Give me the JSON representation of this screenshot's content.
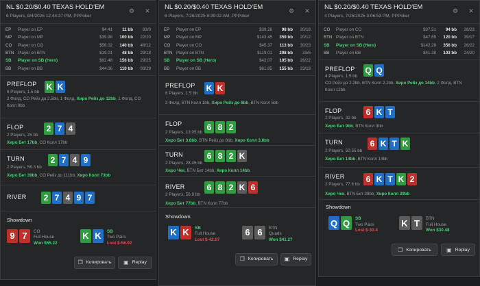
{
  "panels": [
    {
      "title": "NL $0.20/$0.40 TEXAS HOLD'EM",
      "subtitle": "6 Players, 8/4/2025 12:44:37 PM, PPPoker",
      "players": [
        {
          "pos": "EP",
          "name": "Player on EP",
          "stack": "$4.41",
          "bb": "11 bb",
          "stat": "83/0",
          "hero": false
        },
        {
          "pos": "MP",
          "name": "Player on MP",
          "stack": "$39.98",
          "bb": "100 bb",
          "stat": "22/20",
          "hero": false
        },
        {
          "pos": "CO",
          "name": "Player on CO",
          "stack": "$56.02",
          "bb": "140 bb",
          "stat": "46/12",
          "hero": false
        },
        {
          "pos": "BTN",
          "name": "Player on BTN",
          "stack": "$19.01",
          "stat": "29/18",
          "bb": "48 bb",
          "hero": false
        },
        {
          "pos": "SB",
          "name": "Player on SB (Hero)",
          "stack": "$62.48",
          "bb": "156 bb",
          "stat": "29/25",
          "hero": true
        },
        {
          "pos": "BB",
          "name": "Player on BB",
          "stack": "$44.06",
          "bb": "110 bb",
          "stat": "93/29",
          "hero": false
        }
      ],
      "streets": [
        {
          "name": "PREFLOP",
          "info": "6 Players, 1.5 bb",
          "cards": [
            {
              "r": "K",
              "c": "g"
            },
            {
              "r": "K",
              "c": "b"
            }
          ],
          "actions": [
            {
              "t": "2 Фолд, CO Рейз до 2.5bb, 1 Фолд, ",
              "h": false
            },
            {
              "t": "Хиро Рейз до 12bb",
              "h": true
            },
            {
              "t": ", 1 Фолд, CO",
              "h": false
            }
          ],
          "actions2": [
            {
              "t": "Колл 9bb",
              "h": false
            }
          ]
        },
        {
          "name": "FLOP",
          "info": "2 Players, 25 bb",
          "cards": [
            {
              "r": "2",
              "c": "g"
            },
            {
              "r": "7",
              "c": "b"
            },
            {
              "r": "4",
              "c": "k"
            }
          ],
          "actions": [
            {
              "t": "Хиро Бет 17bb",
              "h": true
            },
            {
              "t": ", CO Колл 17bb",
              "h": false
            }
          ],
          "actions2": []
        },
        {
          "name": "TURN",
          "info": "2 Players, 58.3 bb",
          "cards": [
            {
              "r": "2",
              "c": "g"
            },
            {
              "r": "7",
              "c": "b"
            },
            {
              "r": "4",
              "c": "k"
            },
            {
              "r": "9",
              "c": "b"
            }
          ],
          "actions": [
            {
              "t": "2 Players, CO Рейз до 111bb, ",
              "h": false
            },
            {
              "t": "Хиро Колл 73bb",
              "h": true
            }
          ],
          "actions_pre": [
            {
              "t": "Хиро Бет 39bb",
              "h": true
            },
            {
              "t": ", CO Рейз до 111bb, ",
              "h": false
            },
            {
              "t": "Хиро Колл 73bb",
              "h": true
            }
          ],
          "actions2": []
        },
        {
          "name": "RIVER",
          "info": "",
          "cards": [
            {
              "r": "2",
              "c": "g"
            },
            {
              "r": "7",
              "c": "b"
            },
            {
              "r": "4",
              "c": "k"
            },
            {
              "r": "9",
              "c": "b"
            },
            {
              "r": "7",
              "c": "b"
            }
          ],
          "actions": [],
          "actions2": []
        }
      ],
      "showdown_title": "Showdown",
      "showdown": [
        {
          "cards": [
            {
              "r": "9",
              "c": "r"
            },
            {
              "r": "7",
              "c": "r"
            }
          ],
          "name": "CO",
          "hand": "Full House",
          "result": "Won $55.22",
          "won": true,
          "hero": false
        },
        {
          "cards": [
            {
              "r": "K",
              "c": "g"
            },
            {
              "r": "K",
              "c": "b"
            }
          ],
          "name": "SB",
          "hand": "Two Pairs",
          "result": "Lost $-56.02",
          "won": false,
          "hero": true
        }
      ],
      "copy_label": "Копировать",
      "replay_label": "Replay"
    },
    {
      "title": "NL $0.20/$0.40 TEXAS HOLD'EM",
      "subtitle": "6 Players, 7/26/2025 8:39:02 AM, PPPoker",
      "players": [
        {
          "pos": "EP",
          "name": "Player on EP",
          "stack": "$39.26",
          "bb": "98 bb",
          "stat": "20/18",
          "hero": false
        },
        {
          "pos": "MP",
          "name": "Player on MP",
          "stack": "$143.45",
          "bb": "359 bb",
          "stat": "20/12",
          "hero": false
        },
        {
          "pos": "CO",
          "name": "Player on CO",
          "stack": "$45.37",
          "bb": "113 bb",
          "stat": "30/23",
          "hero": false
        },
        {
          "pos": "BTN",
          "name": "Player on BTN",
          "stack": "$119.01",
          "bb": "298 bb",
          "stat": "33/6",
          "hero": false
        },
        {
          "pos": "SB",
          "name": "Player on SB (Hero)",
          "stack": "$42.07",
          "bb": "105 bb",
          "stat": "26/22",
          "hero": true
        },
        {
          "pos": "BB",
          "name": "Player on BB",
          "stack": "$61.85",
          "bb": "155 bb",
          "stat": "23/19",
          "hero": false
        }
      ],
      "streets": [
        {
          "name": "PREFLOP",
          "info": "6 Players, 1.5 bb",
          "cards": [
            {
              "r": "K",
              "c": "b"
            },
            {
              "r": "K",
              "c": "r"
            }
          ],
          "actions": [
            {
              "t": "3 Фолд, BTN Колл 1bb, ",
              "h": false
            },
            {
              "t": "Хиро Рейз до 6bb",
              "h": true
            },
            {
              "t": ", BTN Колл 5bb",
              "h": false
            }
          ],
          "actions2": []
        },
        {
          "name": "FLOP",
          "info": "2 Players, 13.05 bb",
          "cards": [
            {
              "r": "6",
              "c": "g"
            },
            {
              "r": "8",
              "c": "g"
            },
            {
              "r": "2",
              "c": "g"
            }
          ],
          "actions": [
            {
              "t": "Хиро Бет 3.8bb",
              "h": true
            },
            {
              "t": ", BTN Рейз до 8bb, ",
              "h": false
            },
            {
              "t": "Хиро Колл 3.8bb",
              "h": true
            }
          ],
          "actions2": []
        },
        {
          "name": "TURN",
          "info": "2 Players, 28.45 bb",
          "cards": [
            {
              "r": "6",
              "c": "g"
            },
            {
              "r": "8",
              "c": "g"
            },
            {
              "r": "2",
              "c": "g"
            },
            {
              "r": "K",
              "c": "k"
            }
          ],
          "actions": [
            {
              "t": "Хиро Чек",
              "h": true
            },
            {
              "t": ", BTN Бет 14bb, ",
              "h": false
            },
            {
              "t": "Хиро Колл 14bb",
              "h": true
            }
          ],
          "actions2": []
        },
        {
          "name": "RIVER",
          "info": "2 Players, 56.9 bb",
          "cards": [
            {
              "r": "6",
              "c": "g"
            },
            {
              "r": "8",
              "c": "g"
            },
            {
              "r": "2",
              "c": "g"
            },
            {
              "r": "K",
              "c": "k"
            },
            {
              "r": "6",
              "c": "r"
            }
          ],
          "actions": [
            {
              "t": "Хиро Бет 77bb",
              "h": true
            },
            {
              "t": ", BTN Колл 77bb",
              "h": false
            }
          ],
          "actions2": []
        }
      ],
      "showdown_title": "Showdown",
      "showdown": [
        {
          "cards": [
            {
              "r": "K",
              "c": "b"
            },
            {
              "r": "K",
              "c": "r"
            }
          ],
          "name": "SB",
          "hand": "Full House",
          "result": "Lost $-42.07",
          "won": false,
          "hero": true
        },
        {
          "cards": [
            {
              "r": "6",
              "c": "k"
            },
            {
              "r": "6",
              "c": "k"
            }
          ],
          "name": "BTN",
          "hand": "Quads",
          "result": "Won $41.27",
          "won": true,
          "hero": false
        }
      ],
      "copy_label": "Копировать",
      "replay_label": "Replay"
    },
    {
      "title": "NL $0.20/$0.40 TEXAS HOLD'EM",
      "subtitle": "4 Players, 7/25/2025 3:06:53 PM, PPPoker",
      "players": [
        {
          "pos": "CO",
          "name": "Player on CO",
          "stack": "$37.51",
          "bb": "94 bb",
          "stat": "28/23",
          "hero": false
        },
        {
          "pos": "BTN",
          "name": "Player on BTN",
          "stack": "$47.85",
          "bb": "120 bb",
          "stat": "39/17",
          "hero": false
        },
        {
          "pos": "SB",
          "name": "Player on SB (Hero)",
          "stack": "$142.29",
          "bb": "356 bb",
          "stat": "26/22",
          "hero": true
        },
        {
          "pos": "BB",
          "name": "Player on BB",
          "stack": "$41.38",
          "bb": "103 bb",
          "stat": "24/20",
          "hero": false
        }
      ],
      "streets": [
        {
          "name": "PREFLOP",
          "info": "4 Players, 1.5 bb",
          "cards": [
            {
              "r": "Q",
              "c": "g"
            },
            {
              "r": "Q",
              "c": "b"
            }
          ],
          "actions": [
            {
              "t": "CO Рейз до 2.2bb, BTN Колл 2.2bb, ",
              "h": false
            },
            {
              "t": "Хиро Рейз до 14bb",
              "h": true
            },
            {
              "t": ", 2 Фолд, BTN",
              "h": false
            }
          ],
          "actions2": [
            {
              "t": "Колл 12bb",
              "h": false
            }
          ]
        },
        {
          "name": "FLOP",
          "info": "2 Players, 32 bb",
          "cards": [
            {
              "r": "6",
              "c": "r"
            },
            {
              "r": "K",
              "c": "b"
            },
            {
              "r": "T",
              "c": "b"
            }
          ],
          "actions": [
            {
              "t": "Хиро Бет 9bb",
              "h": true
            },
            {
              "t": ", BTN Колл 9bb",
              "h": false
            }
          ],
          "actions2": []
        },
        {
          "name": "TURN",
          "info": "2 Players, 50.55 bb",
          "cards": [
            {
              "r": "6",
              "c": "r"
            },
            {
              "r": "K",
              "c": "b"
            },
            {
              "r": "T",
              "c": "b"
            },
            {
              "r": "K",
              "c": "g"
            }
          ],
          "actions": [
            {
              "t": "Хиро Бет 14bb",
              "h": true
            },
            {
              "t": ", BTN Колл 14bb",
              "h": false
            }
          ],
          "actions2": []
        },
        {
          "name": "RIVER",
          "info": "2 Players, 77.6 bb",
          "cards": [
            {
              "r": "6",
              "c": "r"
            },
            {
              "r": "K",
              "c": "b"
            },
            {
              "r": "T",
              "c": "b"
            },
            {
              "r": "K",
              "c": "g"
            },
            {
              "r": "2",
              "c": "r"
            }
          ],
          "actions": [
            {
              "t": "Хиро Чек",
              "h": true
            },
            {
              "t": ", BTN Бет 39bb, ",
              "h": false
            },
            {
              "t": "Хиро Колл 39bb",
              "h": true
            }
          ],
          "actions2": []
        }
      ],
      "showdown_title": "Showdown",
      "showdown": [
        {
          "cards": [
            {
              "r": "Q",
              "c": "b"
            },
            {
              "r": "Q",
              "c": "g"
            }
          ],
          "name": "SB",
          "hand": "Two Pairs",
          "result": "Lost $-30.4",
          "won": false,
          "hero": true
        },
        {
          "cards": [
            {
              "r": "K",
              "c": "k"
            },
            {
              "r": "T",
              "c": "k"
            }
          ],
          "name": "BTN",
          "hand": "Full House",
          "result": "Won $30.48",
          "won": true,
          "hero": false
        }
      ],
      "copy_label": "Копировать",
      "replay_label": "Replay"
    }
  ],
  "icons": {
    "settings": "gear-icon",
    "close": "close-icon",
    "copy": "copy-icon",
    "replay": "replay-icon"
  }
}
